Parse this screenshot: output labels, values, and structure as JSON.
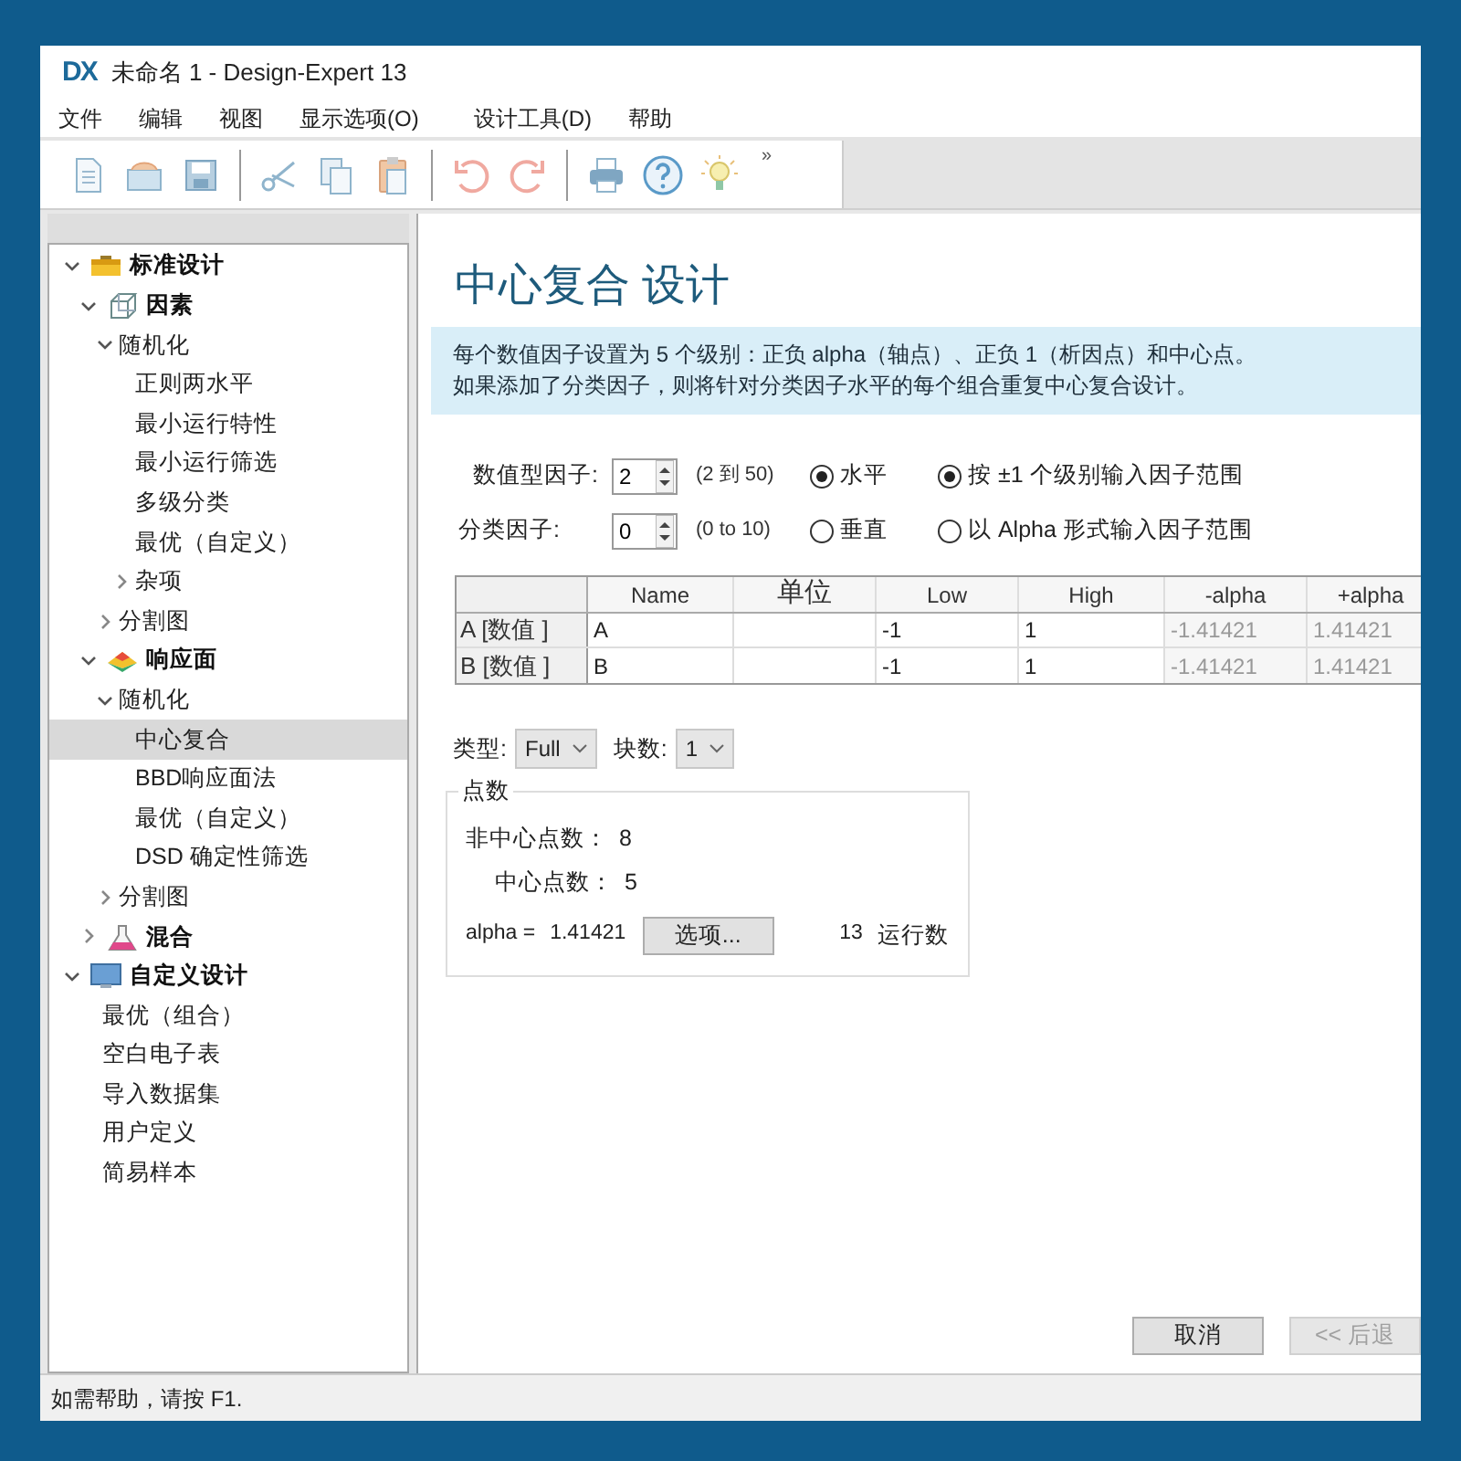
{
  "window": {
    "logo": "DX",
    "title": "未命名 1 - Design-Expert 13"
  },
  "menu": [
    "文件",
    "编辑",
    "视图",
    "显示选项(O)",
    "设计工具(D)",
    "帮助"
  ],
  "toolbar": {
    "overflow": "»"
  },
  "tree": [
    {
      "label": "标准设计",
      "kind": "category",
      "expanded": true,
      "selected": false,
      "children": [
        {
          "label": "因素",
          "kind": "category",
          "expanded": true,
          "selected": false,
          "children": [
            {
              "label": "随机化",
              "kind": "item",
              "expanded": true,
              "selected": false,
              "children": [
                {
                  "label": "正则两水平",
                  "kind": "item",
                  "selected": false
                },
                {
                  "label": "最小运行特性",
                  "kind": "item",
                  "selected": false
                },
                {
                  "label": "最小运行筛选",
                  "kind": "item",
                  "selected": false
                },
                {
                  "label": "多级分类",
                  "kind": "item",
                  "selected": false
                },
                {
                  "label": "最优（自定义）",
                  "kind": "item",
                  "selected": false
                },
                {
                  "label": "杂项",
                  "kind": "item",
                  "expanded": false,
                  "selected": false
                }
              ]
            },
            {
              "label": "分割图",
              "kind": "item",
              "expanded": false,
              "selected": false
            }
          ]
        },
        {
          "label": "响应面",
          "kind": "category",
          "expanded": true,
          "selected": false,
          "children": [
            {
              "label": "随机化",
              "kind": "item",
              "expanded": true,
              "selected": false,
              "children": [
                {
                  "label": "中心复合",
                  "kind": "item",
                  "selected": true
                },
                {
                  "label": "BBD响应面法",
                  "kind": "item",
                  "selected": false
                },
                {
                  "label": "最优（自定义）",
                  "kind": "item",
                  "selected": false
                },
                {
                  "label": "DSD 确定性筛选",
                  "kind": "item",
                  "selected": false
                }
              ]
            },
            {
              "label": "分割图",
              "kind": "item",
              "expanded": false,
              "selected": false
            }
          ]
        },
        {
          "label": "混合",
          "kind": "category",
          "expanded": false,
          "selected": false
        }
      ]
    },
    {
      "label": "自定义设计",
      "kind": "category",
      "expanded": true,
      "selected": false,
      "children": [
        {
          "label": "最优（组合）",
          "kind": "item",
          "selected": false
        },
        {
          "label": "空白电子表",
          "kind": "item",
          "selected": false
        },
        {
          "label": "导入数据集",
          "kind": "item",
          "selected": false
        },
        {
          "label": "用户定义",
          "kind": "item",
          "selected": false
        },
        {
          "label": "简易样本",
          "kind": "item",
          "selected": false
        }
      ]
    }
  ],
  "design": {
    "title": "中心复合 设计",
    "info": [
      "每个数值因子设置为 5 个级别：正负 alpha（轴点）、正负 1（析因点）和中心点。",
      "如果添加了分类因子，则将针对分类因子水平的每个组合重复中心复合设计。"
    ],
    "numeric_factors": {
      "label": "数值型因子:",
      "value": "2",
      "range": "(2 到 50)"
    },
    "categorical_factors": {
      "label": "分类因子:",
      "value": "0",
      "range": "(0 to 10)"
    },
    "orientation": [
      {
        "label": "水平",
        "selected": true
      },
      {
        "label": "垂直",
        "selected": false
      }
    ],
    "range_entry": [
      {
        "label": "按 ±1 个级别输入因子范围",
        "selected": true
      },
      {
        "label": "以 Alpha 形式输入因子范围",
        "selected": false
      }
    ],
    "table": {
      "columns": [
        {
          "label": "Name",
          "readonly": false
        },
        {
          "label": "单位"
        },
        {
          "label": "Low",
          "readonly": false
        },
        {
          "label": "High",
          "readonly": false
        },
        {
          "label": "-alpha",
          "readonly": true
        },
        {
          "label": "+alpha",
          "readonly": true
        }
      ],
      "rows": [
        {
          "header": "A [数值 ]",
          "cells": [
            "A",
            null,
            "-1",
            "1",
            "-1.41421",
            "1.41421"
          ]
        },
        {
          "header": "B [数值 ]",
          "cells": [
            "B",
            null,
            "-1",
            "1",
            "-1.41421",
            "1.41421"
          ]
        }
      ]
    },
    "type": {
      "label": "类型:",
      "value": "Full"
    },
    "blocks": {
      "label": "块数:",
      "value": "1"
    },
    "points": {
      "legend": "点数",
      "non_center": {
        "label": "非中心点数：",
        "value": "8"
      },
      "center": {
        "label": "中心点数：",
        "value": "5"
      },
      "alpha_label": "alpha =",
      "alpha_value": "1.41421",
      "options_button": "选项...",
      "runs_value": "13",
      "runs_label": "运行数"
    },
    "buttons": [
      {
        "label": "取消",
        "disabled": false
      },
      {
        "label": "<< 后退",
        "disabled": true
      }
    ]
  },
  "status_bar": "如需帮助，请按 F1."
}
